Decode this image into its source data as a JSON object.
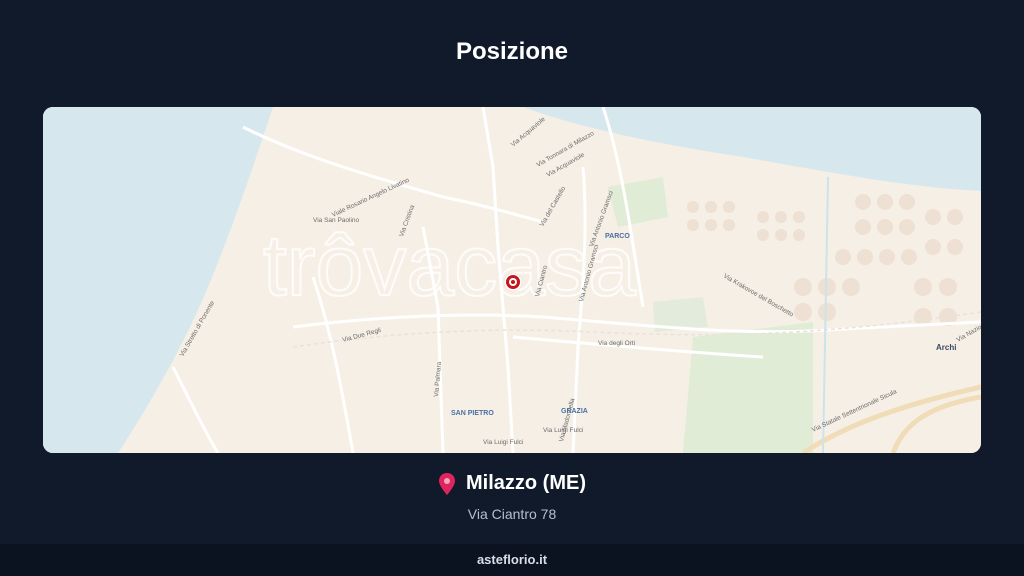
{
  "header": {
    "title": "Posizione"
  },
  "map": {
    "watermark": "trôvacasa",
    "districts": [
      "PARCO",
      "SAN PIETRO",
      "GRAZIA",
      "Archi"
    ],
    "streets": [
      "Via Acquaviole",
      "Via Tonnara di Milazzo",
      "Via Acquaviole",
      "Viale Rosario Angelo Livatino",
      "Via San Paolino",
      "Via Cristina",
      "Via Antonio Gramsci",
      "Via Antonio Gramsci",
      "Via del Castello",
      "Via Ciantro",
      "Via Krakovoe del Boschetto",
      "Via Due Regli",
      "Via degli Orti",
      "Via Luigi Fulci",
      "Via Luigi Fulci",
      "Via Madonnella",
      "Via Palmara",
      "Via Stretto di Ponente",
      "Via Statale Settentrionale Sicula",
      "Via Nazionale"
    ]
  },
  "location": {
    "city": "Milazzo (ME)",
    "address": "Via Ciantro 78"
  },
  "footer": {
    "site": "asteflorio.it"
  },
  "colors": {
    "background": "#111a2b",
    "sea": "#d6e8ee",
    "land": "#f6efe6",
    "park": "#dcebd2",
    "pin": "#c4161c"
  }
}
